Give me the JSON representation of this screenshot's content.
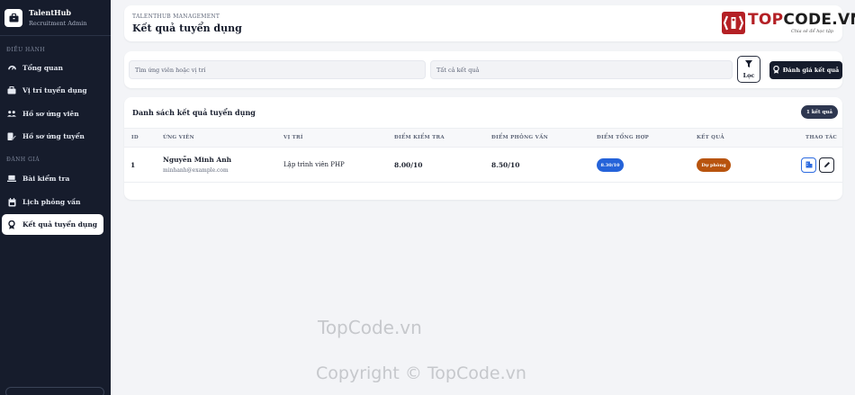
{
  "brand": {
    "title": "TalentHub",
    "subtitle": "Recruitment Admin"
  },
  "sidebar": {
    "section1": "ĐIỀU HÀNH",
    "section2": "ĐÁNH GIÁ",
    "items": [
      {
        "label": "Tổng quan",
        "icon": "dashboard-icon"
      },
      {
        "label": "Vị trí tuyển dụng",
        "icon": "briefcase-icon"
      },
      {
        "label": "Hồ sơ ứng viên",
        "icon": "users-icon"
      },
      {
        "label": "Hồ sơ ứng tuyển",
        "icon": "file-edit-icon"
      },
      {
        "label": "Bài kiểm tra",
        "icon": "laptop-icon"
      },
      {
        "label": "Lịch phỏng vấn",
        "icon": "calendar-icon"
      },
      {
        "label": "Kết quả tuyển dụng",
        "icon": "award-icon",
        "active": true
      }
    ]
  },
  "header": {
    "eyebrow": "TALENTHUB MANAGEMENT",
    "title": "Kết quả tuyển dụng",
    "logo": {
      "part1": "TOP",
      "part2": "CODE.VN",
      "tagline": "Chia sẻ để học tập"
    }
  },
  "filters": {
    "search_placeholder": "Tìm ứng viên hoặc vị trí",
    "select_value": "Tất cả kết quả",
    "filter_label": "Lọc",
    "primary_label": "Đánh giá kết quả"
  },
  "table": {
    "title": "Danh sách kết quả tuyển dụng",
    "count_badge": "1 kết quả",
    "columns": [
      "ID",
      "ỨNG VIÊN",
      "VỊ TRÍ",
      "ĐIỂM KIỂM TRA",
      "ĐIỂM PHỎNG VẤN",
      "ĐIỂM TỔNG HỢP",
      "KẾT QUẢ",
      "THAO TÁC"
    ],
    "rows": [
      {
        "id": "1",
        "name": "Nguyễn Minh Anh",
        "email": "minhanh@example.com",
        "position": "Lập trình viên PHP",
        "test_score": "8.00/10",
        "interview_score": "8.50/10",
        "total_score": "8.30/10",
        "result": "Dự phòng"
      }
    ]
  },
  "watermark": {
    "line1": "TopCode.vn",
    "line2": "Copyright © TopCode.vn"
  },
  "colors": {
    "sidebar": "#161c2c",
    "accent_blue": "#2563d9",
    "result_orange": "#b8540e",
    "logo_red": "#b42025"
  }
}
